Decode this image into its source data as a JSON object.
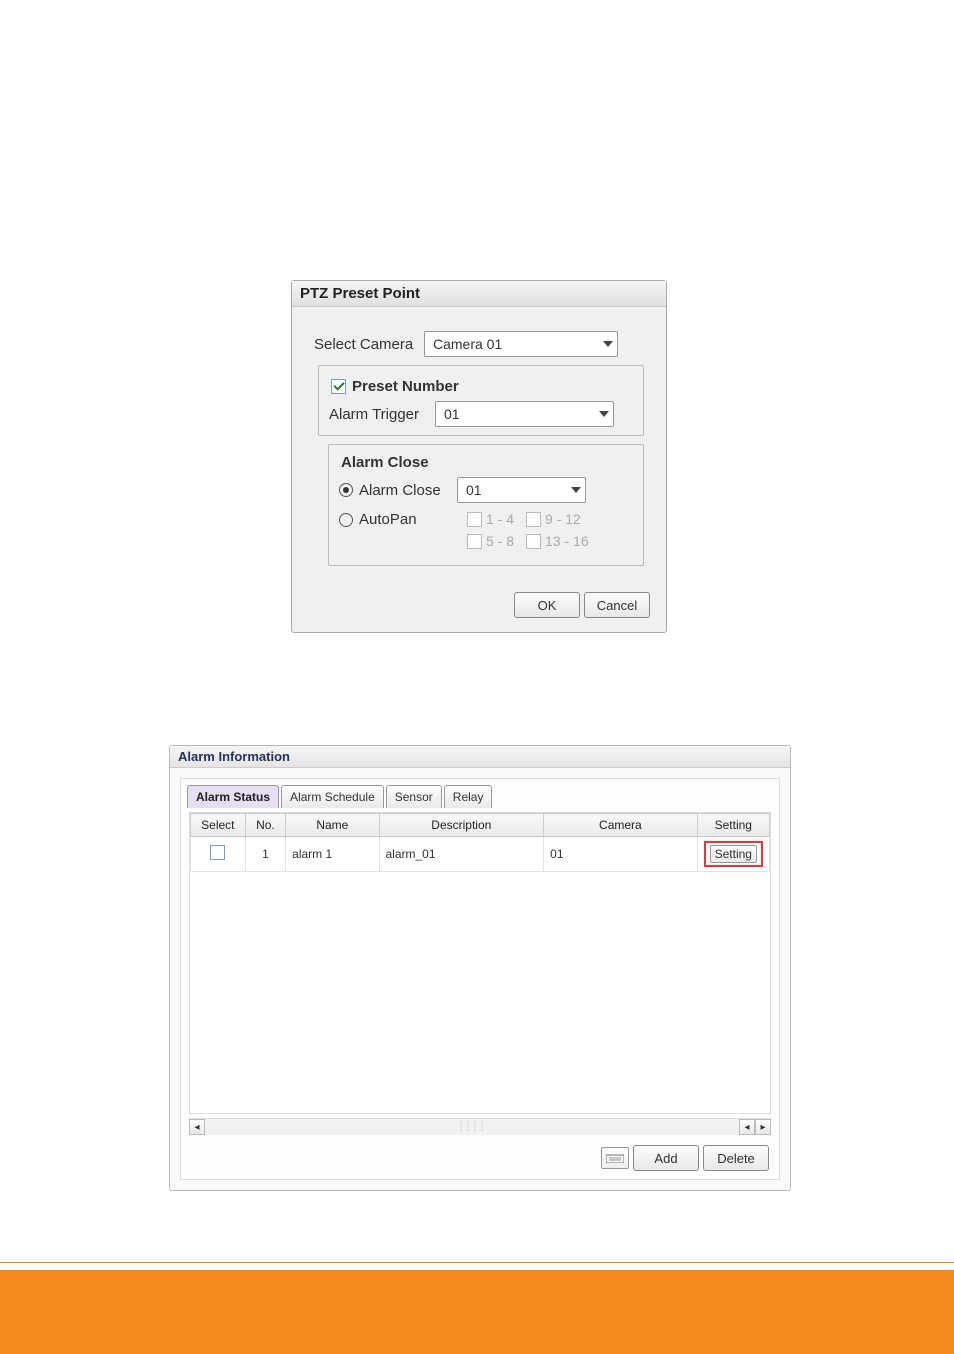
{
  "ptz": {
    "title": "PTZ Preset Point",
    "select_camera_label": "Select Camera",
    "select_camera_value": "Camera 01",
    "preset_number": {
      "label": "Preset Number",
      "checked": true,
      "alarm_trigger_label": "Alarm Trigger",
      "alarm_trigger_value": "01"
    },
    "alarm_close": {
      "group_label": "Alarm Close",
      "radio_alarm_close_label": "Alarm Close",
      "radio_alarm_close_value": "01",
      "radio_autopan_label": "AutoPan",
      "selected_radio": "alarm_close",
      "autopan_options": [
        "1 - 4",
        "9 - 12",
        "5 - 8",
        "13 - 16"
      ]
    },
    "ok_label": "OK",
    "cancel_label": "Cancel"
  },
  "alarm_info": {
    "title": "Alarm Information",
    "tabs": {
      "status": "Alarm Status",
      "schedule": "Alarm Schedule",
      "sensor": "Sensor",
      "relay": "Relay"
    },
    "active_tab": "status",
    "columns": {
      "select": "Select",
      "no": "No.",
      "name": "Name",
      "desc": "Description",
      "camera": "Camera",
      "setting": "Setting"
    },
    "rows": [
      {
        "select": false,
        "no": "1",
        "name": "alarm 1",
        "desc": "alarm_01",
        "camera": "01",
        "setting_label": "Setting"
      }
    ],
    "buttons": {
      "add": "Add",
      "delete": "Delete"
    }
  }
}
